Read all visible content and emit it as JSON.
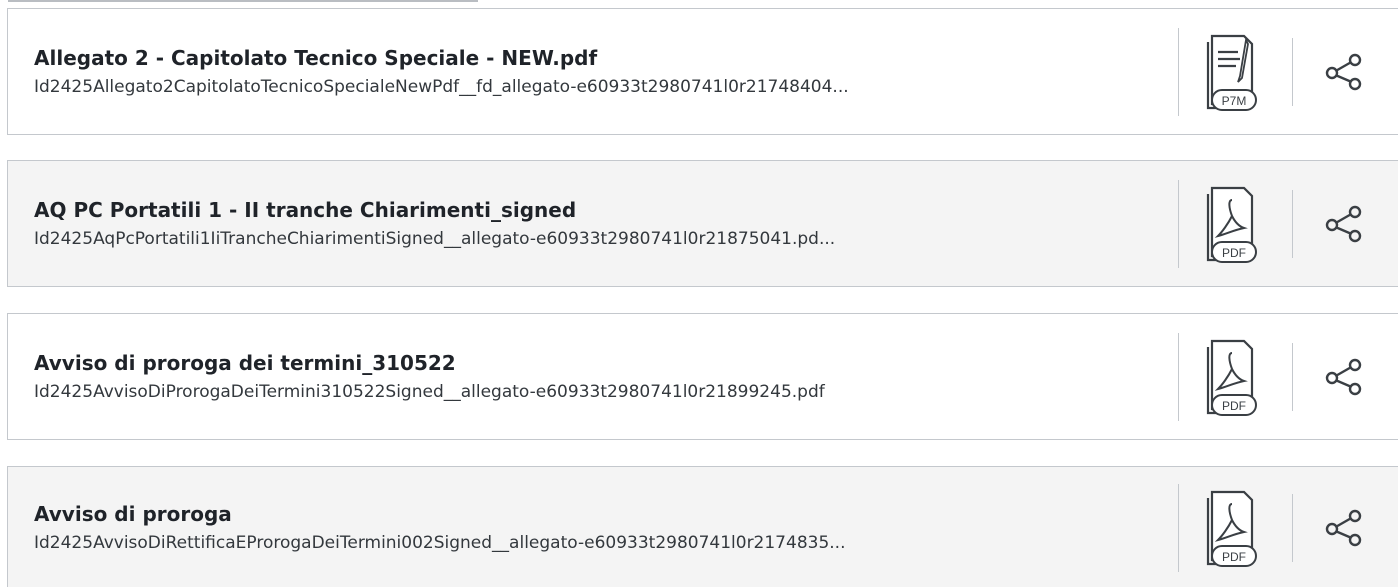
{
  "documents": [
    {
      "title": "Allegato 2 - Capitolato Tecnico Speciale - NEW.pdf",
      "filename": "Id2425Allegato2CapitolatoTecnicoSpecialeNewPdf__fd_allegato-e60933t2980741l0r21748404...",
      "file_type": "P7M",
      "file_icon": "signed-document-p7m-icon",
      "share_icon": "share-icon"
    },
    {
      "title": "AQ PC Portatili 1 - II tranche Chiarimenti_signed",
      "filename": "Id2425AqPcPortatili1IiTrancheChiarimentiSigned__allegato-e60933t2980741l0r21875041.pd...",
      "file_type": "PDF",
      "file_icon": "pdf-document-icon",
      "share_icon": "share-icon"
    },
    {
      "title": "Avviso di proroga dei termini_310522",
      "filename": "Id2425AvvisoDiProrogaDeiTermini310522Signed__allegato-e60933t2980741l0r21899245.pdf",
      "file_type": "PDF",
      "file_icon": "pdf-document-icon",
      "share_icon": "share-icon"
    },
    {
      "title": "Avviso di proroga",
      "filename": "Id2425AvvisoDiRettificaEProrogaDeiTermini002Signed__allegato-e60933t2980741l0r2174835...",
      "file_type": "PDF",
      "file_icon": "pdf-document-icon",
      "share_icon": "share-icon"
    }
  ],
  "colors": {
    "text_title": "#1f2329",
    "text_filename": "#33383d",
    "border": "#c4c8cd",
    "row_alt_background": "#f4f4f4",
    "icon_stroke": "#3a3f44"
  }
}
